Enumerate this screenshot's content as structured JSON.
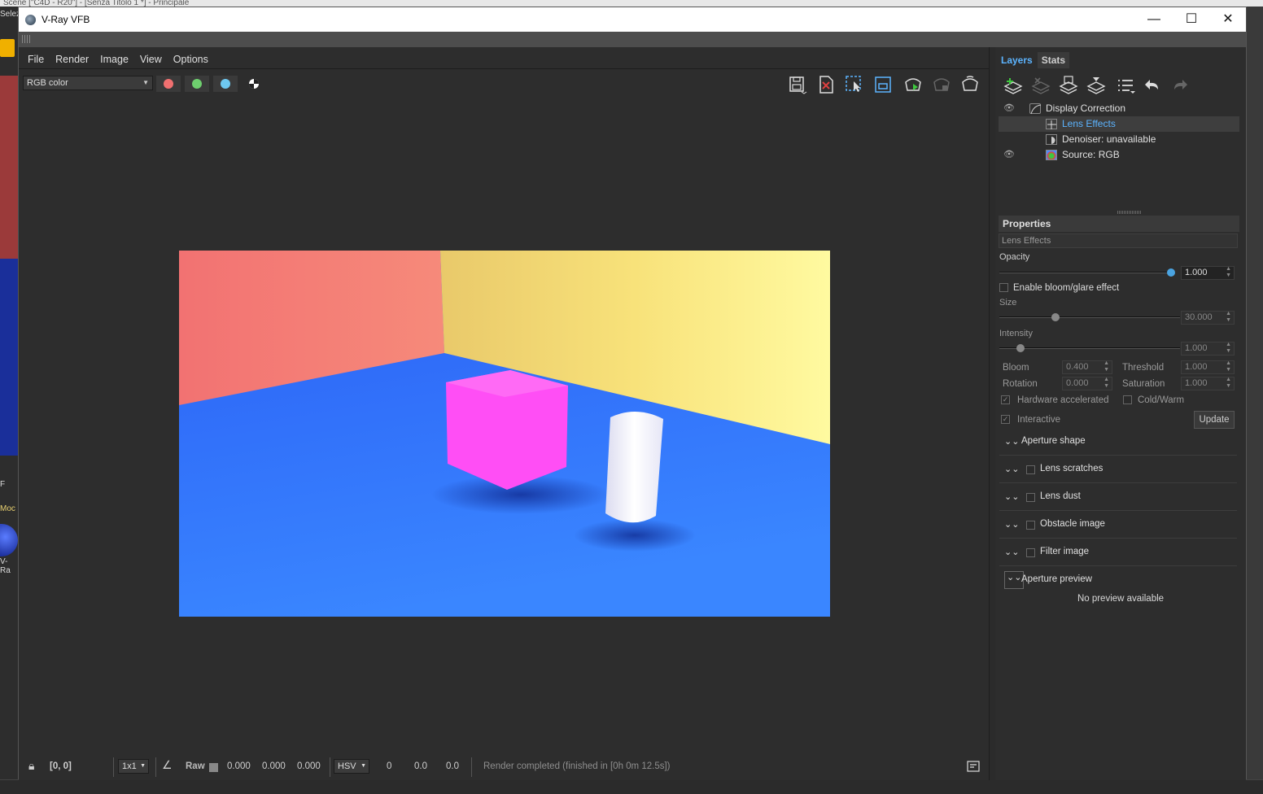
{
  "background_app": {
    "top_strip_text": "Scene [\"C4D - R20\"] - [Senza Titolo 1 *] - Principale",
    "left_labels": [
      "Selez",
      "F",
      "Moc",
      "V-Ra"
    ]
  },
  "window": {
    "title": "V-Ray VFB",
    "controls": {
      "minimize": "—",
      "maximize": "☐",
      "close": "✕"
    }
  },
  "menu": [
    "File",
    "Render",
    "Image",
    "View",
    "Options"
  ],
  "channel": {
    "selected": "RGB color"
  },
  "channel_buttons": [
    {
      "name": "red-channel",
      "color": "#f07070"
    },
    {
      "name": "green-channel",
      "color": "#6ecf6e"
    },
    {
      "name": "blue-channel",
      "color": "#6ec8f0"
    },
    {
      "name": "alpha-channel",
      "color": "#ffffff"
    }
  ],
  "toolbar_icons": [
    "save-image-icon",
    "clear-image-icon",
    "region-render-icon",
    "track-mouse-icon",
    "start-interactive-render-icon",
    "stop-render-icon",
    "render-icon"
  ],
  "render": {
    "colors": {
      "left_wall": "#f27272",
      "back_wall": "#f8e27a",
      "floor": "#2a5ef5",
      "cube": "#ff4ef5",
      "cylinder": "#ffffff"
    }
  },
  "status": {
    "coords": "[0, 0]",
    "sample_size": "1x1",
    "raw_label": "Raw",
    "rgb": [
      "0.000",
      "0.000",
      "0.000"
    ],
    "color_mode": "HSV",
    "hsv": [
      "0",
      "0.0",
      "0.0"
    ],
    "message": "Render completed (finished in [0h  0m 12.5s])"
  },
  "panel": {
    "tabs": [
      "Layers",
      "Stats"
    ],
    "layer_tools": [
      "create-layer-icon",
      "delete-layer-icon",
      "save-layer-tree-icon",
      "load-layer-tree-icon",
      "layer-list-icon",
      "undo-icon",
      "redo-icon"
    ],
    "layers": [
      {
        "name": "Display Correction",
        "visible": true,
        "indent": 0
      },
      {
        "name": "Lens Effects",
        "visible": false,
        "indent": 1,
        "selected": true
      },
      {
        "name": "Denoiser: unavailable",
        "visible": false,
        "indent": 1
      },
      {
        "name": "Source: RGB",
        "visible": true,
        "indent": 1
      }
    ],
    "properties": {
      "header": "Properties",
      "layer_name": "Lens Effects",
      "opacity_label": "Opacity",
      "opacity": "1.000",
      "opacity_level": 1.0,
      "enable_bloom_label": "Enable bloom/glare effect",
      "enable_bloom": false,
      "size_label": "Size",
      "size": "30.000",
      "size_level": 0.3,
      "intensity_label": "Intensity",
      "intensity": "1.000",
      "intensity_level": 0.1,
      "bloom_label": "Bloom",
      "bloom": "0.400",
      "threshold_label": "Threshold",
      "threshold": "1.000",
      "rotation_label": "Rotation",
      "rotation": "0.000",
      "saturation_label": "Saturation",
      "saturation": "1.000",
      "hardware_label": "Hardware accelerated",
      "hardware": true,
      "coldwarm_label": "Cold/Warm",
      "coldwarm": false,
      "interactive_label": "Interactive",
      "interactive": true,
      "update_label": "Update"
    },
    "sections": [
      {
        "label": "Aperture shape",
        "has_check": false
      },
      {
        "label": "Lens scratches",
        "has_check": true
      },
      {
        "label": "Lens dust",
        "has_check": true
      },
      {
        "label": "Obstacle image",
        "has_check": true
      },
      {
        "label": "Filter image",
        "has_check": true
      },
      {
        "label": "Aperture preview",
        "has_check": false
      }
    ],
    "no_preview": "No preview available"
  },
  "accent_color": "#5cb4ff"
}
